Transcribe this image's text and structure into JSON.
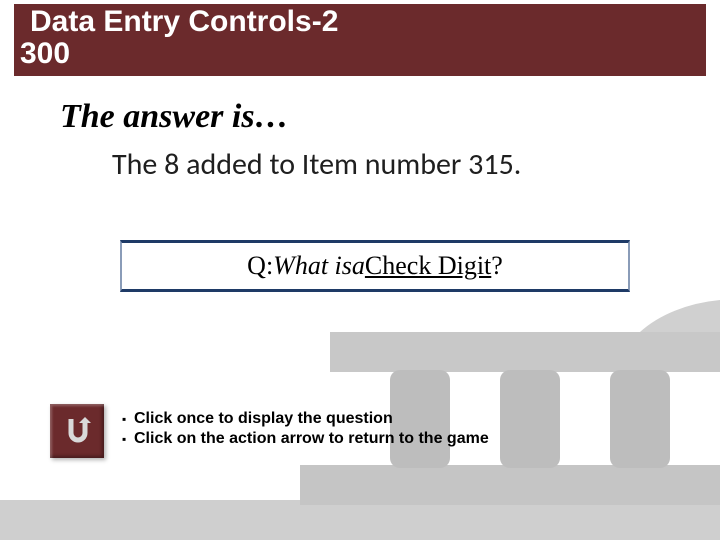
{
  "title": {
    "category": "Data Entry Controls-2",
    "points": "300"
  },
  "answer_is_label": "The answer is…",
  "clue_text": "The 8 added to Item number 315.",
  "question": {
    "prefix": "Q:  ",
    "what": "What is",
    "between": " a ",
    "term": "Check Digit",
    "tail": "?"
  },
  "instructions": [
    "Click once to display the question",
    "Click on the action arrow to return to the game"
  ],
  "icons": {
    "return": "return-u-arrow-icon"
  }
}
